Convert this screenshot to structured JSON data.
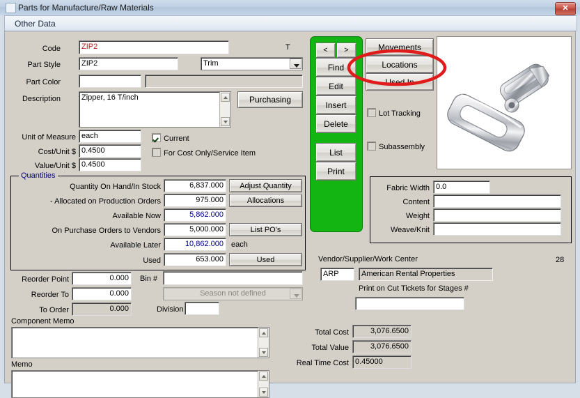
{
  "window": {
    "title": "Parts for Manufacture/Raw Materials",
    "close_label": "✕",
    "tab_label": "Other Data"
  },
  "form": {
    "code_label": "Code",
    "code_value": "ZIP2",
    "code_suffix": "T",
    "part_style_label": "Part Style",
    "part_style_value": "ZIP2",
    "part_type_value": "Trim",
    "part_color_label": "Part Color",
    "part_color_value": "",
    "part_color_desc": "",
    "description_label": "Description",
    "description_value": "Zipper, 16 T/inch",
    "purchasing_label": "Purchasing",
    "uom_label": "Unit of Measure",
    "uom_value": "each",
    "cost_unit_label": "Cost/Unit $",
    "cost_unit_value": "0.4500",
    "value_unit_label": "Value/Unit $",
    "value_unit_value": "0.4500",
    "current_label": "Current",
    "cost_only_label": "For Cost Only/Service Item"
  },
  "quantities": {
    "group_title": "Quantities",
    "rows": [
      {
        "label": "Quantity On Hand/In Stock",
        "value": "6,837.000",
        "button": "Adjust Quantity"
      },
      {
        "label": "- Allocated on Production Orders",
        "value": "975.000",
        "button": "Allocations"
      },
      {
        "label": "Available Now",
        "value": "5,862.000",
        "button": ""
      },
      {
        "label": "On Purchase Orders to Vendors",
        "value": "5,000.000",
        "button": "List PO's"
      },
      {
        "label": "Available Later",
        "value": "10,862.000",
        "button": ""
      },
      {
        "label": "Used",
        "value": "653.000",
        "button": "Used"
      }
    ],
    "unit_suffix": "each"
  },
  "reorder": {
    "reorder_point_label": "Reorder Point",
    "reorder_point_value": "0.000",
    "reorder_to_label": "Reorder To",
    "reorder_to_value": "0.000",
    "to_order_label": "To Order",
    "to_order_value": "0.000",
    "bin_label": "Bin #",
    "bin_value": "",
    "season_value": "Season not defined",
    "division_label": "Division",
    "division_value": ""
  },
  "memos": {
    "component_memo_label": "Component Memo",
    "component_memo_value": "",
    "memo_label": "Memo",
    "memo_value": ""
  },
  "nav": {
    "prev_label": "<",
    "next_label": ">",
    "buttons": [
      "Find",
      "Edit",
      "Insert",
      "Delete",
      "List",
      "Print"
    ],
    "panel_color": "#13b513"
  },
  "actions": {
    "movements_label": "Movements",
    "locations_label": "Locations",
    "used_in_label": "Used In",
    "lot_tracking_label": "Lot Tracking",
    "subassembly_label": "Subassembly",
    "highlight_color": "#e01b1b",
    "highlighted": "Locations"
  },
  "fabric": {
    "fabric_width_label": "Fabric Width",
    "fabric_width_value": "0.0",
    "content_label": "Content",
    "content_value": "",
    "weight_label": "Weight",
    "weight_value": "",
    "weave_knit_label": "Weave/Knit",
    "weave_knit_value": ""
  },
  "vendor": {
    "header_label": "Vendor/Supplier/Work Center",
    "code_value": "ARP",
    "name_value": "American Rental Properties",
    "cut_ticket_label": "Print on Cut Tickets for Stages #",
    "cut_ticket_value": "",
    "record_number": "28"
  },
  "totals": {
    "total_cost_label": "Total Cost",
    "total_cost_value": "3,076.6500",
    "total_value_label": "Total Value",
    "total_value_value": "3,076.6500",
    "real_time_cost_label": "Real Time Cost",
    "real_time_cost_value": "0.45000"
  },
  "image": {
    "alt": "zipper-pull-photo"
  }
}
